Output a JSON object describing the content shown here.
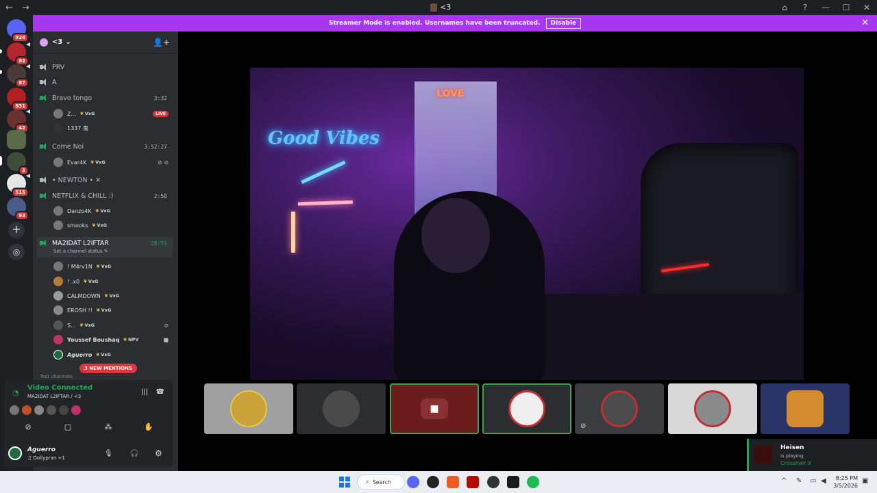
{
  "titlebar": {
    "title": "<3",
    "back": "←",
    "forward": "→",
    "buttons": [
      "⌂",
      "?",
      "—",
      "☐",
      "✕"
    ]
  },
  "banner": {
    "text": "Streamer Mode is enabled. Usernames have been truncated.",
    "disable_label": "Disable",
    "close": "✕"
  },
  "servers": [
    {
      "badge": "924",
      "color": "#5865f2"
    },
    {
      "badge": "83",
      "color": "#b3262d"
    },
    {
      "badge": "87",
      "color": "#4a3b38"
    },
    {
      "badge": "831",
      "color": "#b02020"
    },
    {
      "badge": "42",
      "color": "#6b3030"
    },
    {
      "badge": "",
      "color": "#5a6b4a"
    },
    {
      "badge": "3",
      "color": "#3e4d38"
    },
    {
      "badge": "515",
      "color": "#e6e6e6"
    },
    {
      "badge": "93",
      "color": "#4b5c8a"
    }
  ],
  "channel_header": {
    "server_name": "<3",
    "chevron": "⌄",
    "invite_icon": "👤+"
  },
  "channels": {
    "prv": "PRV",
    "a": "A",
    "bravo": {
      "name": "Bravo tongo",
      "timer": "3:32"
    },
    "come_noi": {
      "name": "Come Noi",
      "timer": "3:52:27"
    },
    "newton": "• NEWTON • ✕",
    "netflix": {
      "name": "NETFLIX & CHILL :)",
      "timer": "2:58"
    },
    "ma2idat": {
      "name": "MA2IDAT L2IFTAR",
      "timer": "28:51",
      "status": "Set a channel status ✎"
    }
  },
  "users": {
    "bravo_1": {
      "name": "Z...",
      "tag": "VxG",
      "live": "LIVE"
    },
    "bravo_2": {
      "name": "1337 鬼"
    },
    "come_1": {
      "name": "Evar4K",
      "tag": "VxG",
      "icons": "⊘ ⊘"
    },
    "netflix_1": {
      "name": "Danzo4K",
      "tag": "VxG"
    },
    "netflix_2": {
      "name": "smooks",
      "tag": "VxG"
    },
    "ma_1": {
      "name": "! M4rv1N",
      "tag": "VxG"
    },
    "ma_2": {
      "name": "! .x0",
      "tag": "VxG"
    },
    "ma_3": {
      "name": "CALMDOWN",
      "tag": "VxG"
    },
    "ma_4": {
      "name": "EROSH !!",
      "tag": "VxG"
    },
    "ma_5": {
      "name": "S...",
      "tag": "VxG",
      "icons": "⊘"
    },
    "ma_6": {
      "name": "Youssef Boushaq",
      "tag": "NPV",
      "icons": "■"
    },
    "ma_7": {
      "name": "Aguerro",
      "tag": "VxG"
    }
  },
  "mentions": "3 NEW MENTIONS",
  "text_channels": "Text channels",
  "voice": {
    "title": "Video Connected",
    "subtitle": "MA2IDAT L2IFTAR / <3",
    "wave": "|||",
    "hangup": "☎",
    "controls": [
      "⊘",
      "▢",
      "⁂",
      "✋"
    ]
  },
  "me": {
    "name": "Aguerro",
    "sub": "♫ Dollypran +1",
    "mic": "🎙",
    "headset": "🎧",
    "gear": "⚙"
  },
  "video": {
    "neon_text": "Good Vibes",
    "neon_sign": "LOVE"
  },
  "participants": [
    {
      "bg": "#a0a0a0",
      "av": "#c9a23a",
      "speaking": false
    },
    {
      "bg": "#2b2d31",
      "av": "#4a4a4a",
      "speaking": false
    },
    {
      "bg": "#6b1d1d",
      "av": "#8a3030",
      "speaking": true
    },
    {
      "bg": "#2b2d31",
      "av": "#555555",
      "speaking": true
    },
    {
      "bg": "#3a3c40",
      "av": "#4c4c4c",
      "speaking": false
    },
    {
      "bg": "#d8d8d8",
      "av": "#8a8a8a",
      "speaking": false
    },
    {
      "bg": "#2b3466",
      "av": "#d48a30",
      "speaking": false
    }
  ],
  "now_playing": {
    "user": "Heisen",
    "activity": "is playing",
    "game": "Crosshair X"
  },
  "taskbar": {
    "search": "Search",
    "time": "8:25 PM",
    "date": "3/5/2026"
  }
}
